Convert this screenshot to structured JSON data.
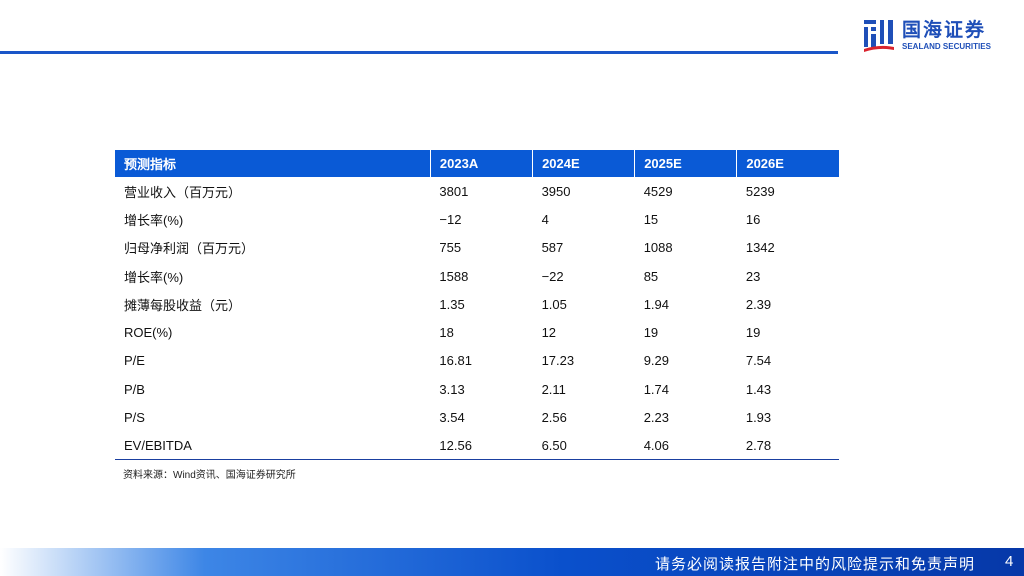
{
  "brand": {
    "name_cn": "国海证券",
    "name_en": "SEALAND SECURITIES",
    "colors": {
      "primary": "#0a5ad6",
      "accent": "#d9232d"
    }
  },
  "table": {
    "headers": [
      "预测指标",
      "2023A",
      "2024E",
      "2025E",
      "2026E"
    ],
    "rows": [
      [
        "营业收入（百万元）",
        "3801",
        "3950",
        "4529",
        "5239"
      ],
      [
        "增长率(%)",
        "−12",
        "4",
        "15",
        "16"
      ],
      [
        "归母净利润（百万元）",
        "755",
        "587",
        "1088",
        "1342"
      ],
      [
        "增长率(%)",
        "1588",
        "−22",
        "85",
        "23"
      ],
      [
        "摊薄每股收益（元）",
        "1.35",
        "1.05",
        "1.94",
        "2.39"
      ],
      [
        "ROE(%)",
        "18",
        "12",
        "19",
        "19"
      ],
      [
        "P/E",
        "16.81",
        "17.23",
        "9.29",
        "7.54"
      ],
      [
        "P/B",
        "3.13",
        "2.11",
        "1.74",
        "1.43"
      ],
      [
        "P/S",
        "3.54",
        "2.56",
        "2.23",
        "1.93"
      ],
      [
        "EV/EBITDA",
        "12.56",
        "6.50",
        "4.06",
        "2.78"
      ]
    ]
  },
  "source": "资料来源：Wind资讯、国海证券研究所",
  "footer": {
    "disclaimer": "请务必阅读报告附注中的风险提示和免责声明",
    "page": "4"
  }
}
